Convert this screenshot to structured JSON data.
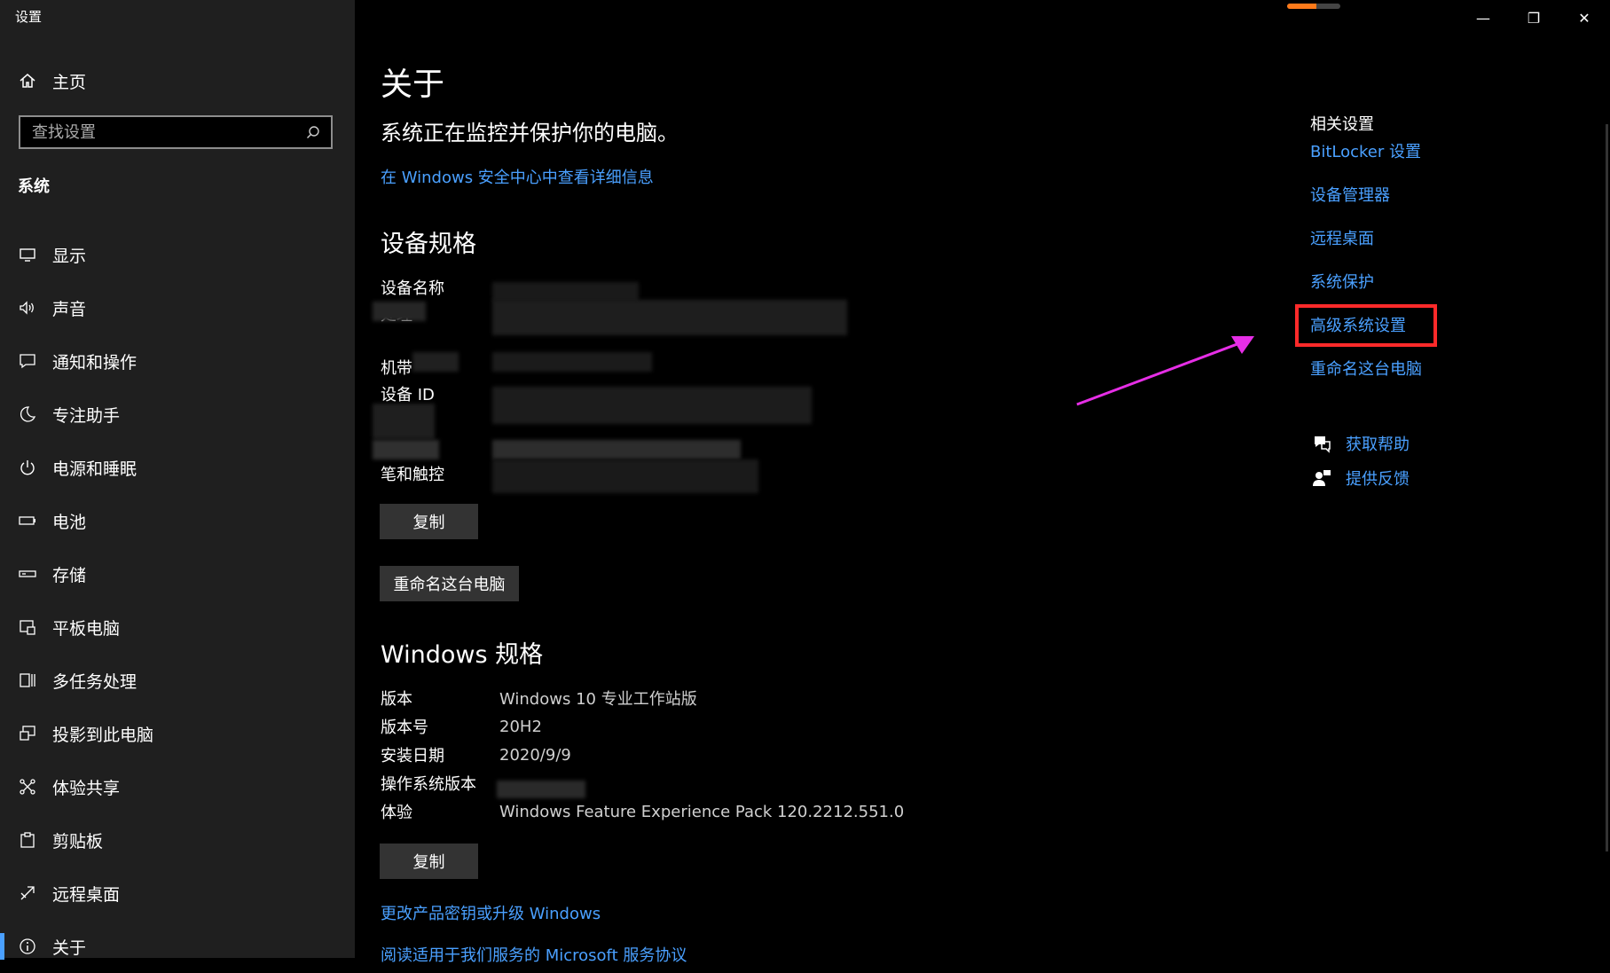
{
  "window": {
    "title": "设置",
    "minimize": "—",
    "restore": "❐",
    "close": "✕",
    "progress_fraction": 0.55
  },
  "sidebar": {
    "home": "主页",
    "search_placeholder": "查找设置",
    "section": "系统",
    "items": [
      {
        "label": "显示",
        "icon": "monitor-icon"
      },
      {
        "label": "声音",
        "icon": "speaker-icon"
      },
      {
        "label": "通知和操作",
        "icon": "notification-icon"
      },
      {
        "label": "专注助手",
        "icon": "moon-icon"
      },
      {
        "label": "电源和睡眠",
        "icon": "power-icon"
      },
      {
        "label": "电池",
        "icon": "battery-icon"
      },
      {
        "label": "存储",
        "icon": "storage-icon"
      },
      {
        "label": "平板电脑",
        "icon": "tablet-icon"
      },
      {
        "label": "多任务处理",
        "icon": "multitask-icon"
      },
      {
        "label": "投影到此电脑",
        "icon": "project-icon"
      },
      {
        "label": "体验共享",
        "icon": "share-icon"
      },
      {
        "label": "剪贴板",
        "icon": "clipboard-icon"
      },
      {
        "label": "远程桌面",
        "icon": "remote-icon"
      },
      {
        "label": "关于",
        "icon": "info-icon",
        "active": true
      }
    ]
  },
  "main": {
    "title": "关于",
    "status": "系统正在监控并保护你的电脑。",
    "security_link": "在 Windows 安全中心中查看详细信息",
    "device_specs": {
      "heading": "设备规格",
      "labels": [
        "设备名称",
        "处理",
        "",
        "机带",
        "设备 ID",
        "",
        "",
        "笔和触控"
      ],
      "copy": "复制",
      "rename": "重命名这台电脑"
    },
    "windows_specs": {
      "heading": "Windows 规格",
      "rows": [
        {
          "key": "版本",
          "value": "Windows 10 专业工作站版"
        },
        {
          "key": "版本号",
          "value": "20H2"
        },
        {
          "key": "安装日期",
          "value": "2020/9/9"
        },
        {
          "key": "操作系统版本",
          "value": ""
        },
        {
          "key": "体验",
          "value": "Windows Feature Experience Pack 120.2212.551.0"
        }
      ],
      "copy": "复制",
      "product_key_link": "更改产品密钥或升级 Windows",
      "terms_link": "阅读适用于我们服务的 Microsoft 服务协议"
    }
  },
  "related": {
    "heading": "相关设置",
    "links": [
      "BitLocker 设置",
      "设备管理器",
      "远程桌面",
      "系统保护",
      "高级系统设置",
      "重命名这台电脑"
    ],
    "help": "获取帮助",
    "feedback": "提供反馈"
  },
  "colors": {
    "accent": "#4aa0ff",
    "highlight": "#ff2a2a",
    "arrow": "#e62ee6"
  }
}
